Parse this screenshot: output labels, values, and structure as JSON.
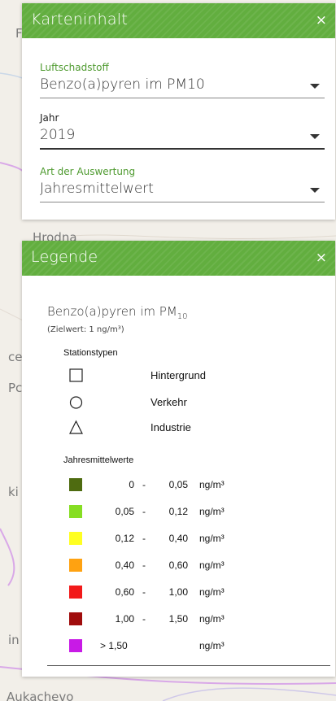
{
  "map": {
    "labels": [
      "Hrodna",
      "Aukachevo",
      "F",
      "ce",
      "Pc",
      "ki",
      "in"
    ]
  },
  "content_panel": {
    "title": "Karteninhalt",
    "close": "×",
    "fields": [
      {
        "label": "Luftschadstoff",
        "value": "Benzo(a)pyren im PM10"
      },
      {
        "label": "Jahr",
        "value": "2019"
      },
      {
        "label": "Art der Auswertung",
        "value": "Jahresmittelwert"
      }
    ]
  },
  "legend_panel": {
    "title": "Legende",
    "close": "×",
    "pollutant_main": "Benzo(a)pyren im PM",
    "pollutant_sub": "10",
    "target_value": "(Zielwert: 1 ng/m³)",
    "station_types_heading": "Stationstypen",
    "station_types": [
      {
        "symbol": "square-icon",
        "label": "Hintergrund"
      },
      {
        "symbol": "circle-icon",
        "label": "Verkehr"
      },
      {
        "symbol": "triangle-icon",
        "label": "Industrie"
      }
    ],
    "classes_heading": "Jahresmittelwerte",
    "unit": "ng/m³",
    "classes": [
      {
        "from": "0",
        "to": "0,05",
        "color": "#4e6b10"
      },
      {
        "from": "0,05",
        "to": "0,12",
        "color": "#86de23"
      },
      {
        "from": "0,12",
        "to": "0,40",
        "color": "#ffff22"
      },
      {
        "from": "0,40",
        "to": "0,60",
        "color": "#ffa211"
      },
      {
        "from": "0,60",
        "to": "1,00",
        "color": "#f21a1a"
      },
      {
        "from": "1,00",
        "to": "1,50",
        "color": "#a00d0d"
      }
    ],
    "last_class": {
      "label": "> 1,50",
      "color": "#c81ae6"
    }
  }
}
